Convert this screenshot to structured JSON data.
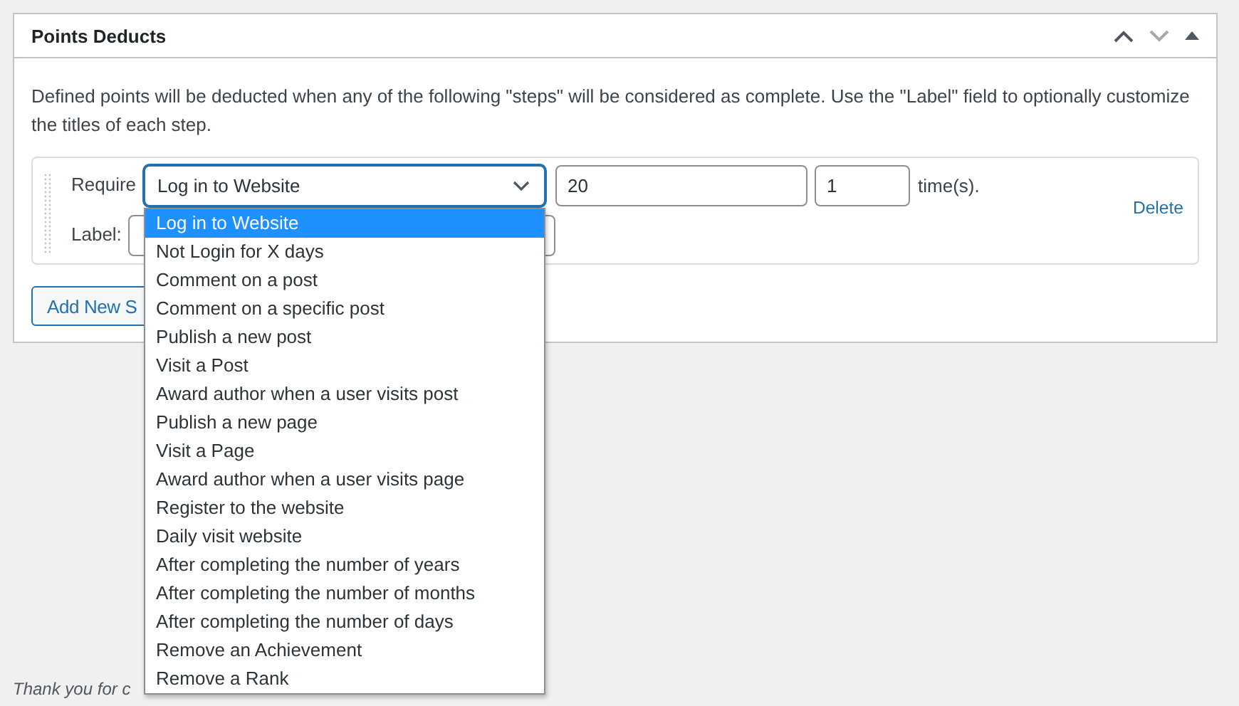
{
  "panel": {
    "title": "Points Deducts",
    "description": "Defined points will be deducted when any of the following \"steps\" will be considered as complete. Use the \"Label\" field to optionally customize the titles of each step."
  },
  "step": {
    "require_label": "Require",
    "select_value": "Log in to Website",
    "points": "20",
    "times": "1",
    "times_suffix": "time(s).",
    "label_label": "Label:",
    "delete": "Delete"
  },
  "dropdown": [
    {
      "label": "Log in to Website",
      "selected": true
    },
    {
      "label": "Not Login for X days",
      "selected": false
    },
    {
      "label": "Comment on a post",
      "selected": false
    },
    {
      "label": "Comment on a specific post",
      "selected": false
    },
    {
      "label": "Publish a new post",
      "selected": false
    },
    {
      "label": "Visit a Post",
      "selected": false
    },
    {
      "label": "Award author when a user visits post",
      "selected": false
    },
    {
      "label": "Publish a new page",
      "selected": false
    },
    {
      "label": "Visit a Page",
      "selected": false
    },
    {
      "label": "Award author when a user visits page",
      "selected": false
    },
    {
      "label": "Register to the website",
      "selected": false
    },
    {
      "label": "Daily visit website",
      "selected": false
    },
    {
      "label": "After completing the number of years",
      "selected": false
    },
    {
      "label": "After completing the number of months",
      "selected": false
    },
    {
      "label": "After completing the number of days",
      "selected": false
    },
    {
      "label": "Remove an Achievement",
      "selected": false
    },
    {
      "label": "Remove a Rank",
      "selected": false
    }
  ],
  "add_button": "Add New S",
  "footer": "Thank you for c"
}
